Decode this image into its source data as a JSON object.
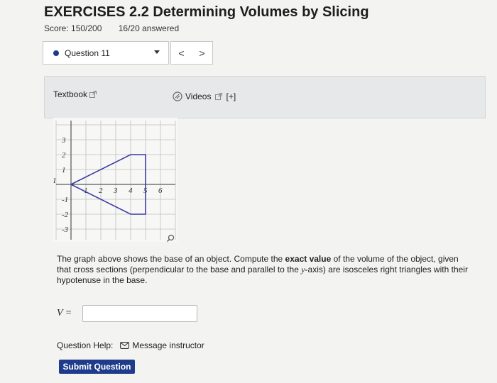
{
  "header": {
    "title": "EXERCISES 2.2 Determining Volumes by Slicing",
    "score": "Score: 150/200",
    "answered": "16/20 answered"
  },
  "question_nav": {
    "selected": "Question 11",
    "prev": "<",
    "next": ">"
  },
  "resources": {
    "textbook": "Textbook",
    "videos": "Videos",
    "videos_expand": "[+]"
  },
  "graph": {
    "x_tick_labels": [
      "1",
      "2",
      "3",
      "4",
      "5",
      "6"
    ],
    "y_tick_labels": [
      "3",
      "2",
      "1",
      "1",
      "-1",
      "-2",
      "-3"
    ],
    "shape_color": "#3a3aa6",
    "vertices": [
      [
        0,
        0
      ],
      [
        4,
        2
      ],
      [
        5,
        2
      ],
      [
        5,
        -2
      ],
      [
        4,
        -2
      ]
    ]
  },
  "question": {
    "text_before": "The graph above shows the base of an object. Compute the ",
    "text_bold": "exact value",
    "text_mid": " of the volume of the object, given that cross sections (perpendicular to the base and parallel to the ",
    "text_var": "y",
    "text_after": "-axis) are isosceles right triangles with their hypotenuse in the base.",
    "var_label": "V ="
  },
  "help": {
    "label": "Question Help:",
    "message": "Message instructor"
  },
  "submit_label": "Submit Question",
  "colors": {
    "accent": "#1f3b8c",
    "panel": "#e7e8ea"
  }
}
